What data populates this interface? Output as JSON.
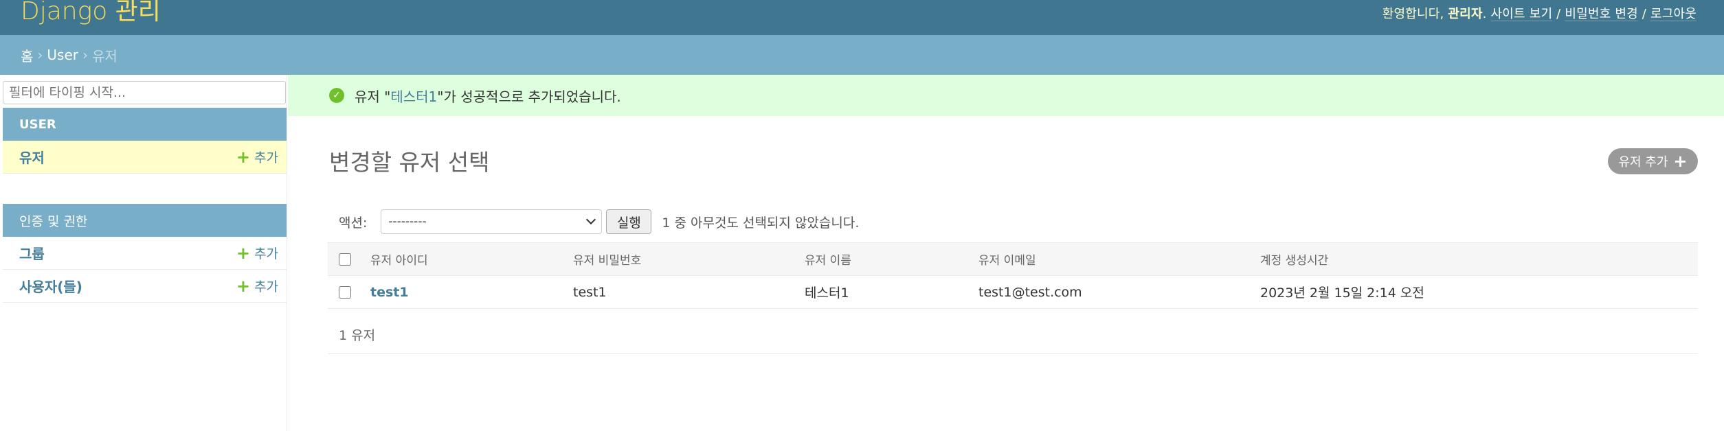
{
  "header": {
    "brand": "Django 관리",
    "welcome": "환영합니다, ",
    "username": "관리자",
    "view_site": "사이트 보기",
    "change_password": "비밀번호 변경",
    "logout": "로그아웃",
    "sep": " / ",
    "dot": ". "
  },
  "breadcrumbs": {
    "home": "홈",
    "app": "User",
    "current": "유저",
    "sep": "›"
  },
  "sidebar": {
    "filter_placeholder": "필터에 타이핑 시작...",
    "modules": [
      {
        "caption": "USER",
        "rows": [
          {
            "name": "유저",
            "add": "추가"
          }
        ]
      },
      {
        "caption": "인증 및 권한",
        "rows": [
          {
            "name": "그룹",
            "add": "추가"
          },
          {
            "name": "사용자(들)",
            "add": "추가"
          }
        ]
      }
    ]
  },
  "message": {
    "prefix": "유저 \"",
    "link": "테스터1",
    "suffix": "\"가 성공적으로 추가되었습니다."
  },
  "main": {
    "title": "변경할 유저 선택",
    "add_button": "유저 추가",
    "action_label": "액션:",
    "action_value": "---------",
    "go_button": "실행",
    "selection_counter": "1 중 아무것도 선택되지 않았습니다.",
    "columns": [
      "유저 아이디",
      "유저 비밀번호",
      "유저 이름",
      "유저 이메일",
      "계정 생성시간"
    ],
    "rows": [
      {
        "id": "test1",
        "password": "test1",
        "name": "테스터1",
        "email": "test1@test.com",
        "created": "2023년 2월 15일 2:14 오전"
      }
    ],
    "paginator": "1 유저"
  },
  "colors": {
    "header": "#417690",
    "breadcrumbs": "#79aec8",
    "brand": "#f5dd5d",
    "link": "#447e9b",
    "success_bg": "#dfd",
    "add_green": "#70bf2b"
  }
}
